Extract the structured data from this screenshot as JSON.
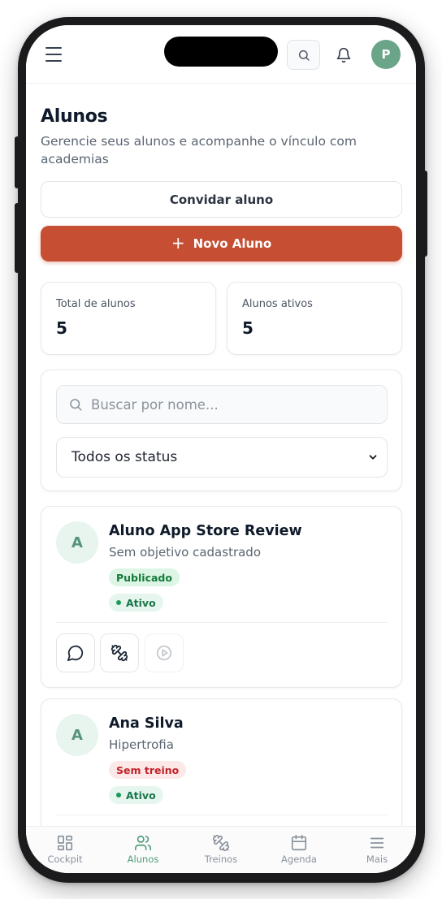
{
  "header": {
    "menu_icon": "hamburger-menu-icon",
    "search_icon": "search-icon",
    "notification_icon": "bell-icon",
    "avatar_initial": "P",
    "avatar_color": "#6aa58a"
  },
  "page": {
    "title": "Alunos",
    "subtitle": "Gerencie seus alunos e acompanhe o vínculo com academias"
  },
  "actions": {
    "invite_label": "Convidar aluno",
    "new_label": "Novo Aluno",
    "new_icon": "plus-icon",
    "accent_color": "#c64e33"
  },
  "stats": [
    {
      "label": "Total de alunos",
      "value": "5"
    },
    {
      "label": "Alunos ativos",
      "value": "5"
    }
  ],
  "filters": {
    "search_placeholder": "Buscar por nome...",
    "search_value": "",
    "status_selected": "Todos os status"
  },
  "students": [
    {
      "initial": "A",
      "name": "Aluno App Store Review",
      "goal": "Sem objetivo cadastrado",
      "badge1": "Publicado",
      "badge1_tone": "green",
      "status": "Ativo",
      "actions": [
        "message-icon",
        "dumbbell-icon",
        "play-icon"
      ]
    },
    {
      "initial": "A",
      "name": "Ana Silva",
      "goal": "Hipertrofia",
      "badge1": "Sem treino",
      "badge1_tone": "red",
      "status": "Ativo",
      "actions": [
        "message-icon",
        "dumbbell-icon",
        "play-icon"
      ]
    }
  ],
  "nav": [
    {
      "label": "Cockpit",
      "icon": "grid-icon",
      "active": false
    },
    {
      "label": "Alunos",
      "icon": "users-icon",
      "active": true
    },
    {
      "label": "Treinos",
      "icon": "dumbbell-icon",
      "active": false
    },
    {
      "label": "Agenda",
      "icon": "calendar-icon",
      "active": false
    },
    {
      "label": "Mais",
      "icon": "menu-icon",
      "active": false
    }
  ]
}
